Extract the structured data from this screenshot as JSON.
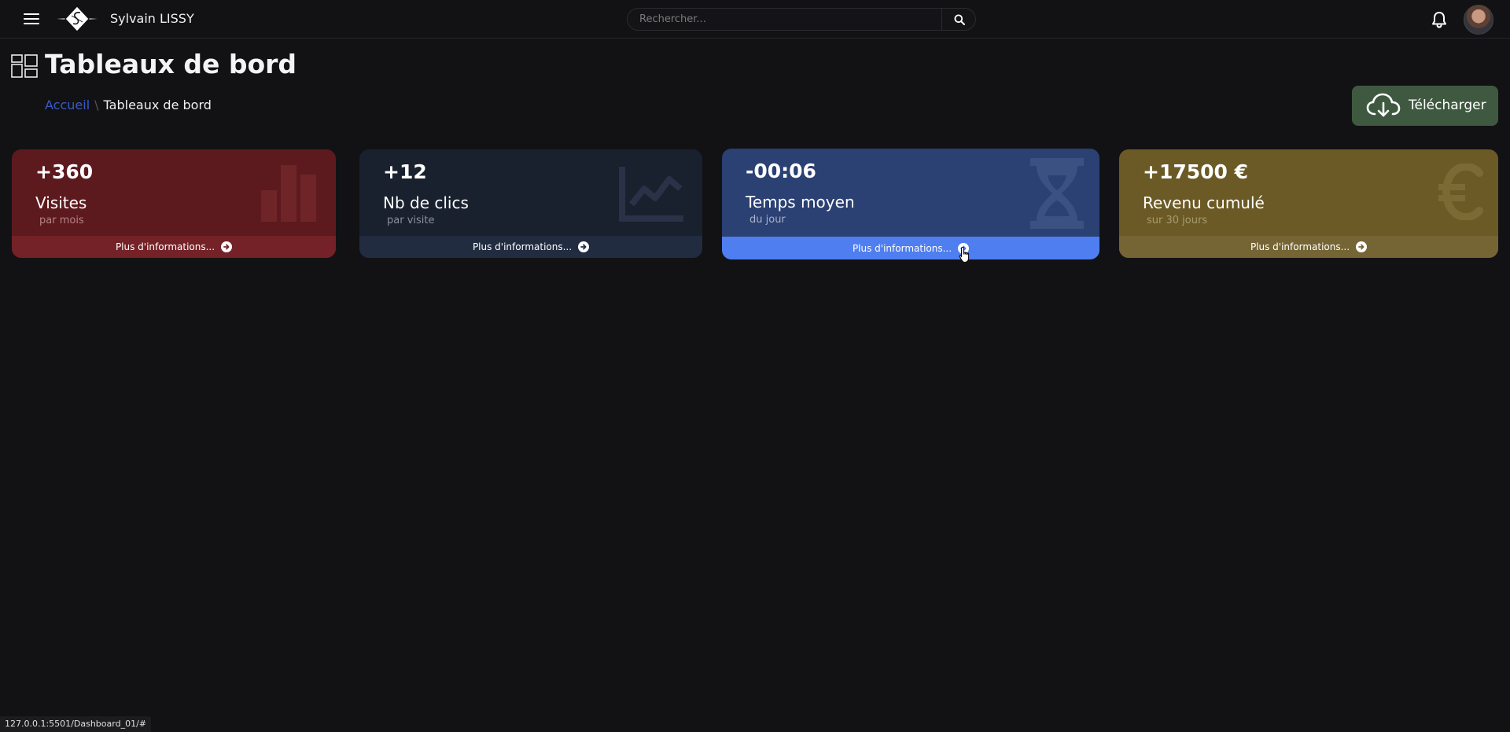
{
  "navbar": {
    "brand_name": "Sylvain LISSY",
    "search_placeholder": "Rechercher...",
    "icons": [
      "menu-icon",
      "logo",
      "search-icon",
      "bell-icon",
      "avatar"
    ]
  },
  "page": {
    "title": "Tableaux de bord",
    "breadcrumb": {
      "home": "Accueil",
      "separator": "\\",
      "current": "Tableaux de bord"
    },
    "download_label": "Télécharger"
  },
  "cards": [
    {
      "value": "+360",
      "label": "Visites",
      "sub": "par mois",
      "footer": "Plus d'informations...",
      "icon": "bar-chart-icon",
      "color": "#5d1a1e"
    },
    {
      "value": "+12",
      "label": "Nb de clics",
      "sub": "par visite",
      "footer": "Plus d'informations...",
      "icon": "line-chart-icon",
      "color": "#19202e"
    },
    {
      "value": "-00:06",
      "label": "Temps moyen",
      "sub": "du jour",
      "footer": "Plus d'informations...",
      "icon": "hourglass-icon",
      "color": "#2b4073"
    },
    {
      "value": "+17500 €",
      "label": "Revenu cumulé",
      "sub": "sur 30 jours",
      "footer": "Plus d'informations...",
      "icon": "euro-icon",
      "color": "#6b5a25"
    }
  ],
  "status_bar": {
    "url": "127.0.0.1:5501/Dashboard_01/#"
  }
}
